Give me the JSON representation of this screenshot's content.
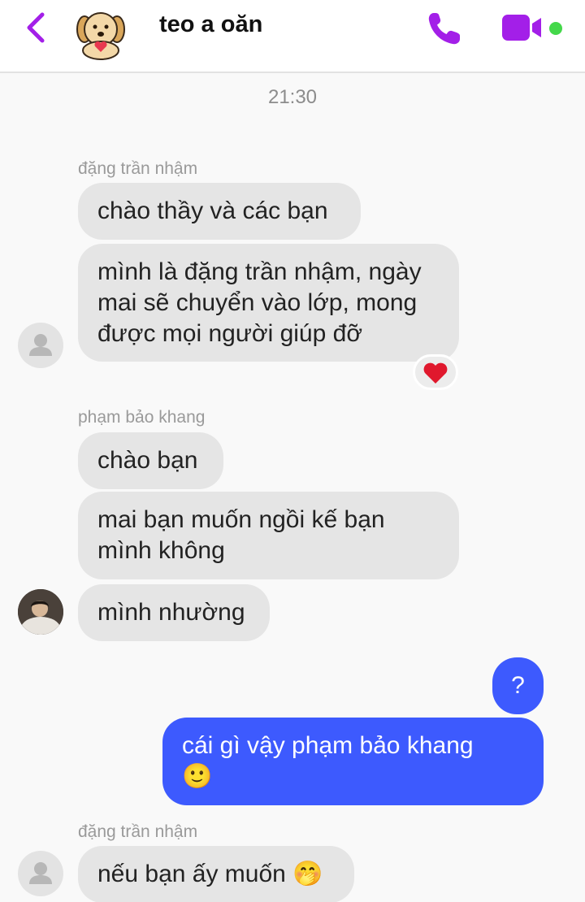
{
  "header": {
    "title": "teo a oăn",
    "accent_color": "#a31fe8",
    "online_color": "#44d84a"
  },
  "chat": {
    "timestamp": "21:30",
    "groups": [
      {
        "sender": "đặng trần nhậm",
        "messages": [
          "chào thầy và các bạn",
          "mình là đặng trần nhậm, ngày\nmai sẽ chuyển vào lớp, mong\nđược mọi người giúp đỡ"
        ],
        "reaction": "❤️"
      },
      {
        "sender": "phạm bảo khang",
        "messages": [
          "chào bạn",
          "mai bạn muốn ngồi kế bạn\nmình không",
          "mình nhường"
        ]
      },
      {
        "sender": "me",
        "messages": [
          "?",
          "cái gì vậy phạm bảo khang\n🙂"
        ]
      },
      {
        "sender": "đặng trần nhậm",
        "messages": [
          "nếu bạn ấy muốn 🤭"
        ]
      }
    ]
  },
  "colors": {
    "incoming_bubble": "#e5e5e5",
    "outgoing_bubble": "#3d5afe"
  }
}
